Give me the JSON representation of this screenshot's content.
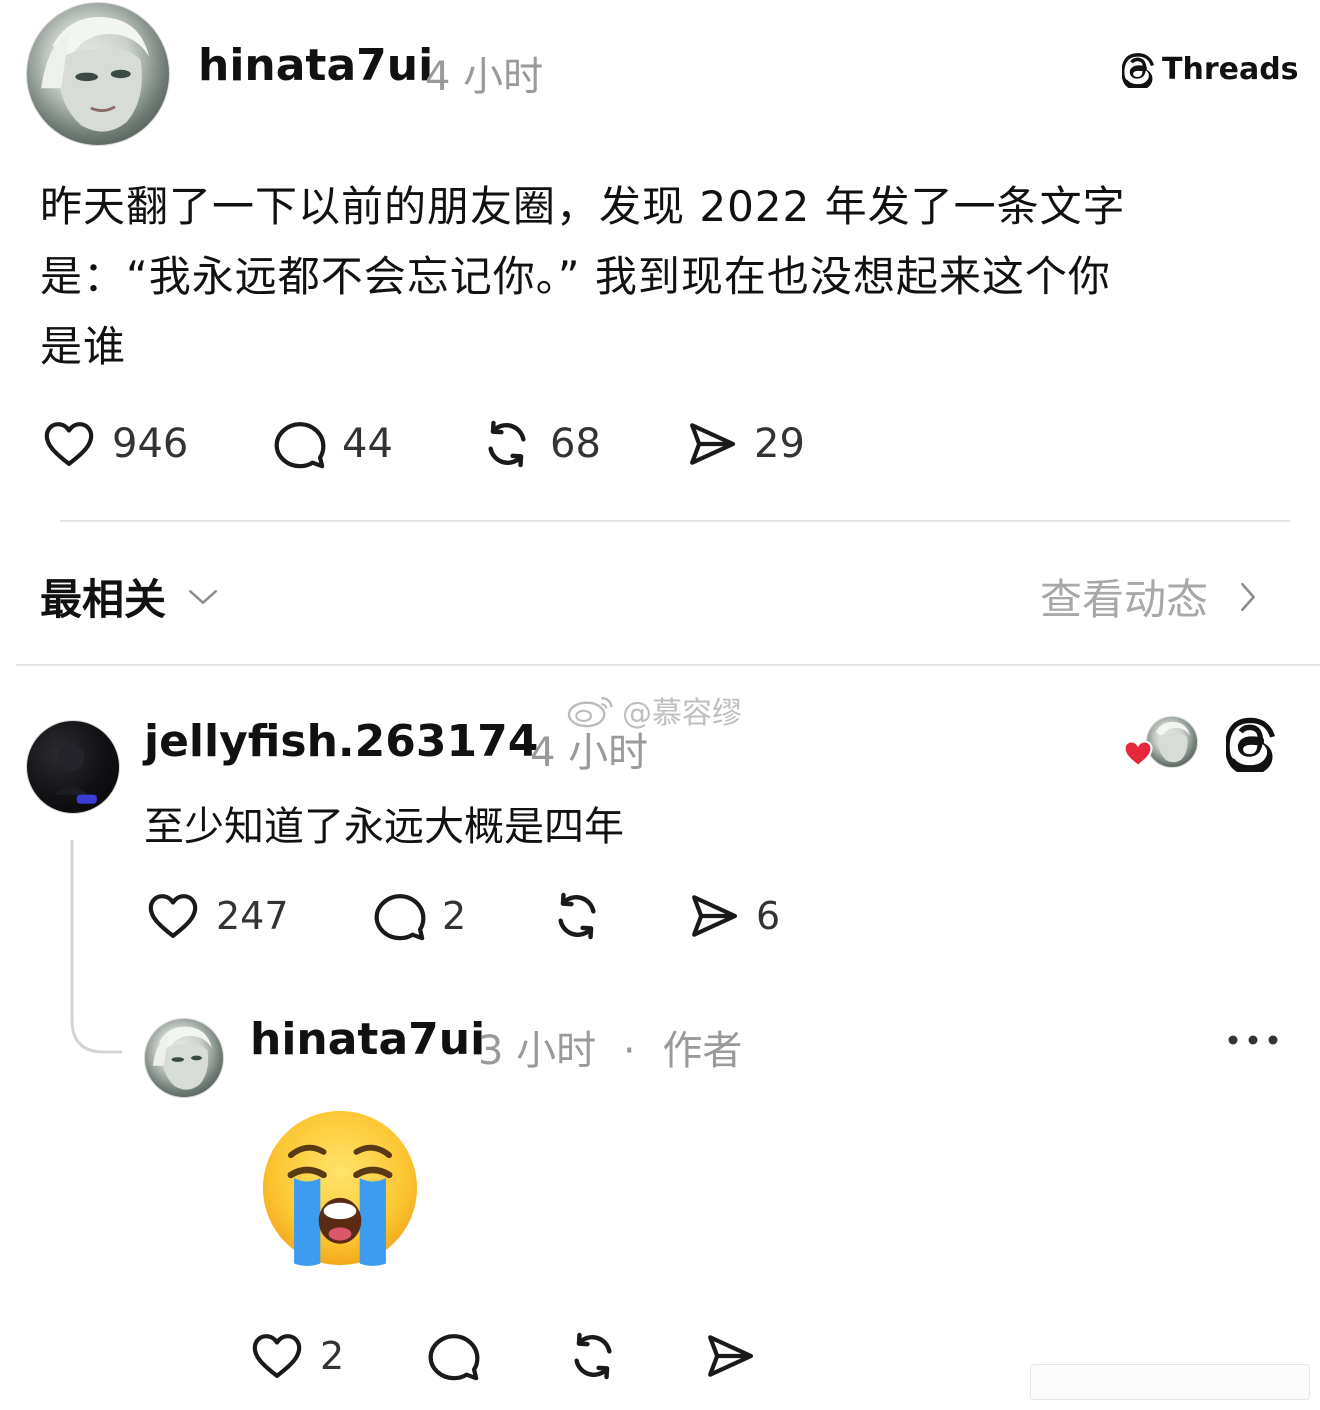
{
  "post": {
    "username": "hinata7ui",
    "time": "4 小时",
    "brand": "Threads",
    "text_lines": [
      "昨天翻了一下以前的朋友圈，发现 2022 年发了一条文字",
      "是：“我永远都不会忘记你。” 我到现在也没想起来这个你",
      "是谁"
    ],
    "actions": {
      "likes": "946",
      "comments": "44",
      "reposts": "68",
      "shares": "29"
    }
  },
  "sort": {
    "label": "最相关",
    "activity_link": "查看动态"
  },
  "watermark": "@慕容缪",
  "reply": {
    "username": "jellyfish.263174",
    "time": "4 小时",
    "text": "至少知道了永远大概是四年",
    "actions": {
      "likes": "247",
      "comments": "2",
      "shares": "6"
    }
  },
  "author_reply": {
    "username": "hinata7ui",
    "time": "3 小时",
    "separator": "·",
    "author_tag": "作者",
    "emoji": "loudly-crying-face",
    "actions": {
      "likes": "2"
    }
  },
  "colors": {
    "heart_red": "#e8283c",
    "muted_text": "#9a9a9a",
    "divider": "#e4e4e4"
  }
}
